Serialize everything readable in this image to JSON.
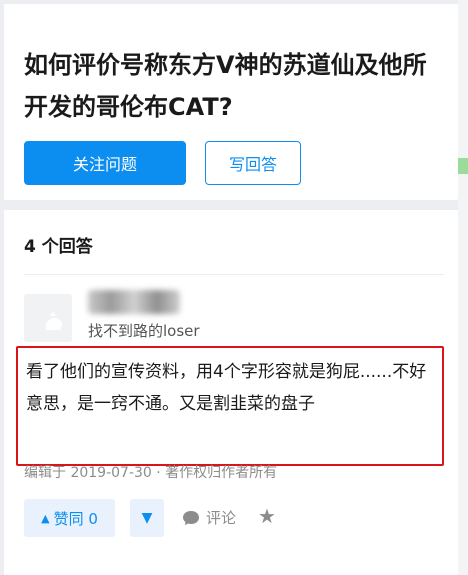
{
  "question": {
    "title": "如何评价号称东方V神的苏道仙及他所开发的哥伦布CAT?",
    "follow_label": "关注问题",
    "answer_label": "写回答"
  },
  "answers": {
    "count_label": "4 个回答",
    "items": [
      {
        "author_bio": "找不到路的loser",
        "content": "看了他们的宣传资料，用4个字形容就是狗屁......不好意思，是一窍不通。又是割韭菜的盘子",
        "meta": "编辑于 2019-07-30 · 著作权归作者所有",
        "upvote_label": "赞同 0",
        "comment_label": "评论"
      }
    ]
  },
  "icons": {
    "upvote": "triangle-up-icon",
    "downvote": "triangle-down-icon",
    "comment": "comment-bubble-icon",
    "favorite": "star-icon"
  },
  "colors": {
    "primary": "#0c8ef0",
    "highlight_border": "#d9141b",
    "muted_text": "#8c8c8c"
  }
}
